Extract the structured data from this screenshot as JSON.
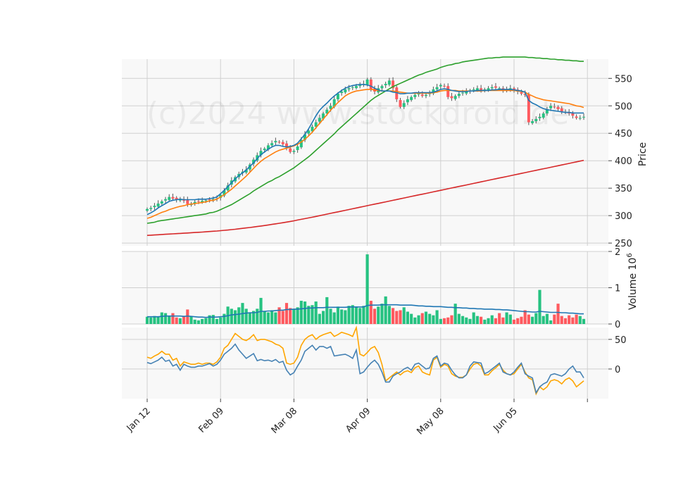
{
  "colors": {
    "up": "#26c281",
    "down": "#ff5a5f",
    "ma_fast": "#1f77b4",
    "ma_mid": "#ff7f0e",
    "ma_slow": "#2ca02c",
    "ma_long": "#d62728",
    "volume_ma": "#1f77b4",
    "osc_a": "#4682b4",
    "osc_b": "#ffa500"
  },
  "watermark": "(c)2024 www.stockdroid.de",
  "chart_data": {
    "type": "candlestick",
    "x_ticks": [
      {
        "label": "Jan 12",
        "index": 0
      },
      {
        "label": "Feb 09",
        "index": 20
      },
      {
        "label": "Mar 08",
        "index": 40
      },
      {
        "label": "Apr 09",
        "index": 60
      },
      {
        "label": "May 08",
        "index": 80
      },
      {
        "label": "Jun 05",
        "index": 100
      },
      {
        "label": "",
        "index": 120
      }
    ],
    "n": 120,
    "price": {
      "ylabel": "Price",
      "ylim": [
        245,
        585
      ],
      "yticks": [
        250,
        300,
        350,
        400,
        450,
        500,
        550
      ],
      "close": [
        312,
        314,
        318,
        322,
        326,
        330,
        334,
        331,
        329,
        330,
        327,
        321,
        322,
        325,
        326,
        327,
        328,
        329,
        330,
        331,
        338,
        346,
        355,
        364,
        370,
        376,
        380,
        384,
        393,
        402,
        410,
        418,
        422,
        428,
        432,
        436,
        434,
        430,
        424,
        416,
        418,
        426,
        438,
        448,
        455,
        462,
        470,
        478,
        486,
        493,
        500,
        512,
        522,
        526,
        530,
        532,
        534,
        536,
        538,
        540,
        548,
        530,
        526,
        532,
        536,
        540,
        546,
        532,
        512,
        498,
        505,
        512,
        516,
        520,
        522,
        518,
        520,
        524,
        530,
        534,
        538,
        536,
        516,
        514,
        518,
        522,
        524,
        526,
        528,
        530,
        532,
        528,
        530,
        532,
        534,
        533,
        532,
        528,
        530,
        532,
        528,
        526,
        522,
        520,
        470,
        472,
        476,
        480,
        486,
        494,
        500,
        498,
        494,
        490,
        488,
        486,
        482,
        478,
        478,
        480
      ],
      "ma_fast": [
        302,
        305,
        309,
        314,
        318,
        322,
        326,
        328,
        329,
        330,
        329,
        329,
        329,
        329,
        330,
        330,
        330,
        331,
        332,
        334,
        340,
        346,
        353,
        360,
        367,
        373,
        378,
        383,
        390,
        396,
        404,
        411,
        416,
        421,
        425,
        428,
        428,
        426,
        425,
        426,
        428,
        432,
        440,
        448,
        458,
        470,
        482,
        492,
        499,
        505,
        512,
        518,
        523,
        528,
        532,
        535,
        537,
        538,
        539,
        539,
        538,
        536,
        532,
        529,
        527,
        527,
        527,
        525,
        524,
        522,
        522,
        523,
        523,
        524,
        524,
        524,
        524,
        524,
        525,
        527,
        530,
        531,
        530,
        528,
        527,
        526,
        526,
        526,
        527,
        527,
        528,
        528,
        528,
        528,
        529,
        529,
        530,
        530,
        530,
        530,
        529,
        528,
        527,
        525,
        510,
        505,
        502,
        498,
        495,
        493,
        492,
        491,
        490,
        489,
        488,
        488,
        487,
        487,
        487,
        487
      ],
      "ma_mid": [
        295,
        297,
        300,
        303,
        306,
        308,
        311,
        313,
        315,
        317,
        318,
        320,
        321,
        322,
        323,
        324,
        325,
        327,
        328,
        330,
        334,
        338,
        343,
        348,
        354,
        360,
        366,
        372,
        379,
        386,
        393,
        399,
        404,
        408,
        412,
        416,
        419,
        421,
        423,
        425,
        427,
        430,
        434,
        439,
        445,
        452,
        460,
        468,
        476,
        484,
        492,
        499,
        506,
        512,
        518,
        522,
        525,
        527,
        528,
        529,
        530,
        530,
        529,
        528,
        527,
        527,
        527,
        527,
        526,
        525,
        524,
        523,
        523,
        523,
        523,
        523,
        523,
        523,
        524,
        525,
        527,
        528,
        528,
        528,
        528,
        527,
        527,
        527,
        527,
        527,
        527,
        527,
        528,
        528,
        528,
        528,
        528,
        528,
        528,
        528,
        528,
        527,
        526,
        525,
        521,
        518,
        515,
        513,
        511,
        510,
        509,
        508,
        507,
        506,
        505,
        504,
        502,
        500,
        499,
        497
      ],
      "ma_slow": [
        286,
        287,
        288,
        290,
        291,
        292,
        293,
        294,
        295,
        296,
        297,
        298,
        299,
        300,
        301,
        302,
        303,
        305,
        306,
        308,
        311,
        314,
        317,
        320,
        324,
        328,
        332,
        336,
        340,
        345,
        349,
        353,
        357,
        361,
        364,
        368,
        371,
        375,
        379,
        383,
        387,
        392,
        397,
        402,
        407,
        413,
        419,
        425,
        431,
        437,
        443,
        449,
        456,
        462,
        468,
        474,
        480,
        486,
        492,
        498,
        504,
        510,
        515,
        519,
        523,
        527,
        531,
        535,
        538,
        541,
        544,
        547,
        550,
        553,
        556,
        558,
        561,
        563,
        565,
        567,
        570,
        572,
        574,
        575,
        577,
        578,
        580,
        581,
        582,
        583,
        584,
        585,
        586,
        587,
        587,
        588,
        588,
        589,
        589,
        589,
        589,
        589,
        589,
        589,
        588,
        588,
        587,
        587,
        586,
        586,
        585,
        585,
        584,
        584,
        583,
        583,
        582,
        582,
        581,
        581
      ],
      "ma_long": [
        264,
        264.4,
        264.8,
        265.2,
        265.6,
        266,
        266.4,
        266.8,
        267.2,
        267.6,
        268,
        268.4,
        268.8,
        269.2,
        269.6,
        270,
        270.5,
        271,
        271.5,
        272,
        272.6,
        273.2,
        273.8,
        274.5,
        275.2,
        276,
        276.8,
        277.6,
        278.4,
        279.3,
        280.2,
        281.1,
        282,
        283,
        284,
        285,
        286,
        287.1,
        288.2,
        289.4,
        290.6,
        291.9,
        293.2,
        294.5,
        295.8,
        297.1,
        298.5,
        299.9,
        301.3,
        302.7,
        304.1,
        305.5,
        306.9,
        308.3,
        309.7,
        311.1,
        312.5,
        313.9,
        315.3,
        316.7,
        318.1,
        319.5,
        320.9,
        322.3,
        323.7,
        325.1,
        326.5,
        327.9,
        329.3,
        330.7,
        332.1,
        333.5,
        334.9,
        336.3,
        337.7,
        339.1,
        340.5,
        341.9,
        343.3,
        344.7,
        346.1,
        347.5,
        348.9,
        350.3,
        351.7,
        353.1,
        354.5,
        355.9,
        357.3,
        358.7,
        360.1,
        361.5,
        362.9,
        364.3,
        365.7,
        367.1,
        368.5,
        369.9,
        371.3,
        372.7,
        374.1,
        375.5,
        376.9,
        378.3,
        379.7,
        381.1,
        382.5,
        383.9,
        385.3,
        386.7,
        388.1,
        389.5,
        390.9,
        392.3,
        393.7,
        395.1,
        396.5,
        397.9,
        399.3,
        400.7
      ]
    },
    "volume": {
      "ylabel": "Volume  10^6",
      "ylim": [
        0,
        2
      ],
      "yticks": [
        0,
        1,
        2
      ],
      "values": [
        0.2,
        0.18,
        0.22,
        0.2,
        0.32,
        0.3,
        0.22,
        0.3,
        0.18,
        0.16,
        0.22,
        0.4,
        0.22,
        0.12,
        0.1,
        0.14,
        0.16,
        0.24,
        0.25,
        0.14,
        0.18,
        0.28,
        0.48,
        0.42,
        0.38,
        0.46,
        0.58,
        0.42,
        0.32,
        0.36,
        0.42,
        0.72,
        0.34,
        0.32,
        0.38,
        0.32,
        0.46,
        0.36,
        0.58,
        0.44,
        0.4,
        0.46,
        0.64,
        0.62,
        0.5,
        0.52,
        0.62,
        0.28,
        0.36,
        0.74,
        0.42,
        0.32,
        0.48,
        0.4,
        0.38,
        0.5,
        0.52,
        0.46,
        0.44,
        0.5,
        1.92,
        0.64,
        0.42,
        0.48,
        0.56,
        0.76,
        0.5,
        0.44,
        0.36,
        0.38,
        0.46,
        0.34,
        0.28,
        0.18,
        0.24,
        0.3,
        0.34,
        0.28,
        0.24,
        0.38,
        0.14,
        0.16,
        0.18,
        0.24,
        0.56,
        0.28,
        0.22,
        0.18,
        0.14,
        0.32,
        0.22,
        0.2,
        0.12,
        0.16,
        0.24,
        0.16,
        0.3,
        0.18,
        0.32,
        0.26,
        0.12,
        0.16,
        0.2,
        0.38,
        0.26,
        0.2,
        0.3,
        0.94,
        0.22,
        0.28,
        0.1,
        0.26,
        0.56,
        0.22,
        0.16,
        0.24,
        0.18,
        0.26,
        0.22,
        0.14
      ],
      "ma": [
        0.2,
        0.2,
        0.2,
        0.2,
        0.21,
        0.22,
        0.22,
        0.22,
        0.22,
        0.22,
        0.21,
        0.22,
        0.21,
        0.2,
        0.19,
        0.19,
        0.18,
        0.19,
        0.19,
        0.19,
        0.2,
        0.21,
        0.23,
        0.25,
        0.26,
        0.27,
        0.29,
        0.3,
        0.31,
        0.31,
        0.32,
        0.35,
        0.35,
        0.36,
        0.36,
        0.37,
        0.38,
        0.38,
        0.4,
        0.4,
        0.41,
        0.41,
        0.42,
        0.43,
        0.44,
        0.44,
        0.45,
        0.45,
        0.45,
        0.46,
        0.46,
        0.46,
        0.46,
        0.46,
        0.46,
        0.47,
        0.47,
        0.47,
        0.47,
        0.47,
        0.51,
        0.52,
        0.52,
        0.52,
        0.53,
        0.53,
        0.53,
        0.53,
        0.53,
        0.52,
        0.52,
        0.52,
        0.52,
        0.51,
        0.5,
        0.5,
        0.49,
        0.49,
        0.48,
        0.48,
        0.48,
        0.47,
        0.46,
        0.46,
        0.45,
        0.45,
        0.44,
        0.44,
        0.43,
        0.43,
        0.42,
        0.42,
        0.41,
        0.41,
        0.41,
        0.4,
        0.4,
        0.39,
        0.39,
        0.38,
        0.37,
        0.36,
        0.35,
        0.34,
        0.34,
        0.33,
        0.33,
        0.35,
        0.34,
        0.33,
        0.32,
        0.32,
        0.32,
        0.31,
        0.31,
        0.3,
        0.3,
        0.29,
        0.28,
        0.28
      ]
    },
    "oscillator": {
      "ylim": [
        -50,
        70
      ],
      "yticks": [
        0,
        50
      ],
      "series_a": [
        11,
        9,
        12,
        15,
        20,
        13,
        15,
        5,
        8,
        -2,
        8,
        5,
        3,
        3,
        5,
        5,
        7,
        9,
        5,
        8,
        15,
        25,
        30,
        35,
        42,
        32,
        25,
        18,
        22,
        26,
        14,
        16,
        14,
        15,
        13,
        16,
        11,
        13,
        -2,
        -10,
        -6,
        5,
        15,
        30,
        35,
        40,
        32,
        38,
        38,
        35,
        38,
        22,
        23,
        24,
        25,
        22,
        18,
        32,
        -8,
        -5,
        3,
        10,
        15,
        8,
        -5,
        -22,
        -22,
        -12,
        -8,
        -5,
        0,
        3,
        -2,
        8,
        10,
        5,
        0,
        2,
        18,
        22,
        5,
        10,
        8,
        -2,
        -10,
        -15,
        -15,
        -10,
        5,
        12,
        11,
        10,
        -8,
        -5,
        0,
        5,
        10,
        -5,
        -8,
        -10,
        -5,
        3,
        10,
        -8,
        -12,
        -15,
        -40,
        -30,
        -25,
        -22,
        -10,
        -8,
        -10,
        -12,
        -8,
        0,
        5,
        -5,
        -5,
        -15
      ],
      "series_b": [
        20,
        18,
        22,
        25,
        30,
        25,
        25,
        15,
        18,
        5,
        12,
        10,
        8,
        8,
        10,
        8,
        10,
        10,
        8,
        12,
        20,
        35,
        40,
        50,
        60,
        55,
        50,
        48,
        52,
        58,
        48,
        50,
        50,
        48,
        46,
        42,
        40,
        35,
        10,
        8,
        10,
        20,
        40,
        50,
        55,
        58,
        50,
        55,
        58,
        60,
        62,
        55,
        58,
        62,
        60,
        58,
        55,
        70,
        25,
        22,
        28,
        35,
        38,
        28,
        8,
        -20,
        -15,
        -10,
        -5,
        -10,
        -5,
        -3,
        -6,
        2,
        5,
        -5,
        -8,
        -10,
        15,
        20,
        3,
        8,
        5,
        -8,
        -12,
        -14,
        -14,
        -10,
        0,
        8,
        10,
        5,
        -10,
        -10,
        -3,
        2,
        8,
        -2,
        -8,
        -10,
        -8,
        0,
        8,
        -5,
        -15,
        -18,
        -42,
        -30,
        -35,
        -30,
        -20,
        -18,
        -20,
        -25,
        -18,
        -15,
        -20,
        -30,
        -25,
        -20
      ]
    }
  }
}
